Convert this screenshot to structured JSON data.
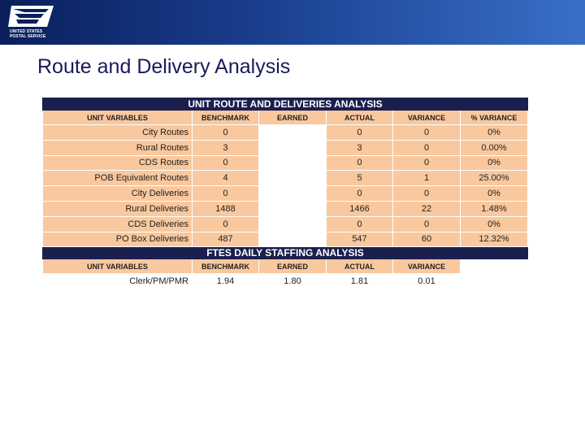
{
  "header": {
    "logo_line1": "UNITED STATES",
    "logo_line2": "POSTAL SERVICE"
  },
  "title": "Route and Delivery Analysis",
  "route_table": {
    "heading": "UNIT ROUTE AND DELIVERIES ANALYSIS",
    "columns": [
      "UNIT VARIABLES",
      "BENCHMARK",
      "EARNED",
      "ACTUAL",
      "VARIANCE",
      "% VARIANCE"
    ],
    "rows": [
      {
        "label": "City Routes",
        "benchmark": "0",
        "actual": "0",
        "variance": "0",
        "pct": "0%"
      },
      {
        "label": "Rural Routes",
        "benchmark": "3",
        "actual": "3",
        "variance": "0",
        "pct": "0.00%"
      },
      {
        "label": "CDS Routes",
        "benchmark": "0",
        "actual": "0",
        "variance": "0",
        "pct": "0%"
      },
      {
        "label": "POB Equivalent Routes",
        "benchmark": "4",
        "actual": "5",
        "variance": "1",
        "pct": "25.00%"
      },
      {
        "label": "City Deliveries",
        "benchmark": "0",
        "actual": "0",
        "variance": "0",
        "pct": "0%"
      },
      {
        "label": "Rural Deliveries",
        "benchmark": "1488",
        "actual": "1466",
        "variance": "22",
        "pct": "1.48%"
      },
      {
        "label": "CDS Deliveries",
        "benchmark": "0",
        "actual": "0",
        "variance": "0",
        "pct": "0%"
      },
      {
        "label": "PO Box Deliveries",
        "benchmark": "487",
        "actual": "547",
        "variance": "60",
        "pct": "12.32%"
      }
    ]
  },
  "staffing_table": {
    "heading": "FTES DAILY STAFFING ANALYSIS",
    "columns": [
      "UNIT VARIABLES",
      "BENCHMARK",
      "EARNED",
      "ACTUAL",
      "VARIANCE"
    ],
    "rows": [
      {
        "label": "Clerk/PM/PMR",
        "benchmark": "1.94",
        "earned": "1.80",
        "actual": "1.81",
        "variance": "0.01"
      }
    ]
  }
}
